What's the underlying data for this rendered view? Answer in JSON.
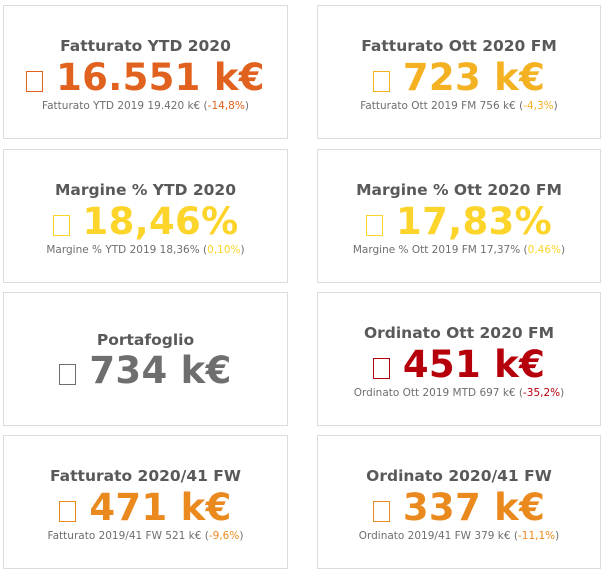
{
  "colors": {
    "orange_dark": "#e0621e",
    "amber": "#f4b122",
    "yellow": "#fcd42a",
    "grey": "#6e6e6e",
    "red": "#b5000c",
    "orange": "#ea8a1e"
  },
  "kpis": [
    {
      "title": "Fatturato YTD 2020",
      "value": "16.551 k€",
      "sub_prefix": "Fatturato YTD 2019 19.420 k€ (",
      "sub_delta": "-14,8%",
      "sub_suffix": ")",
      "color": "#e0621e",
      "delta_color": "#e0621e"
    },
    {
      "title": "Fatturato Ott 2020 FM",
      "value": "723 k€",
      "sub_prefix": "Fatturato Ott 2019 FM 756 k€ (",
      "sub_delta": "-4,3%",
      "sub_suffix": ")",
      "color": "#f4b122",
      "delta_color": "#f4b122"
    },
    {
      "title": "Margine % YTD 2020",
      "value": "18,46%",
      "sub_prefix": "Margine % YTD 2019 18,36% (",
      "sub_delta": "0,10%",
      "sub_suffix": ")",
      "color": "#fcd42a",
      "delta_color": "#fcd42a"
    },
    {
      "title": "Margine % Ott 2020 FM",
      "value": "17,83%",
      "sub_prefix": "Margine % Ott 2019 FM 17,37% (",
      "sub_delta": "0,46%",
      "sub_suffix": ")",
      "color": "#fcd42a",
      "delta_color": "#fcd42a"
    },
    {
      "title": "Portafoglio",
      "value": "734 k€",
      "color": "#6e6e6e"
    },
    {
      "title": "Ordinato Ott 2020 FM",
      "value": "451 k€",
      "sub_prefix": "Ordinato Ott 2019 MTD 697 k€ (",
      "sub_delta": "-35,2%",
      "sub_suffix": ")",
      "color": "#b5000c",
      "delta_color": "#b5000c"
    },
    {
      "title": "Fatturato 2020/41 FW",
      "value": "471 k€",
      "sub_prefix": "Fatturato 2019/41 FW 521 k€ (",
      "sub_delta": "-9,6%",
      "sub_suffix": ")",
      "color": "#ea8a1e",
      "delta_color": "#ea8a1e"
    },
    {
      "title": "Ordinato 2020/41 FW",
      "value": "337 k€",
      "sub_prefix": "Ordinato 2019/41 FW 379 k€ (",
      "sub_delta": "-11,1%",
      "sub_suffix": ")",
      "color": "#ea8a1e",
      "delta_color": "#ea8a1e"
    }
  ]
}
